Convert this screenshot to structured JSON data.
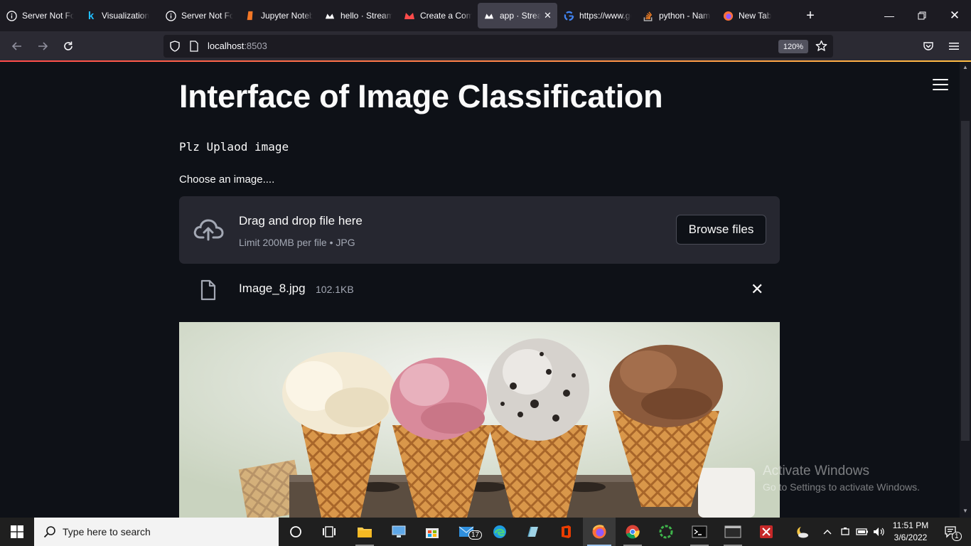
{
  "browser": {
    "tabs": [
      {
        "title": "Server Not Found",
        "icon": "info-icon"
      },
      {
        "title": "Visualization",
        "icon": "kaggle-icon"
      },
      {
        "title": "Server Not Found",
        "icon": "info-icon"
      },
      {
        "title": "Jupyter Notebook",
        "icon": "jupyter-icon"
      },
      {
        "title": "hello · Streamlit",
        "icon": "streamlit-icon"
      },
      {
        "title": "Create a Component",
        "icon": "streamlit-icon"
      },
      {
        "title": "app · Streamlit",
        "icon": "streamlit-icon",
        "active": true
      },
      {
        "title": "https://www.google.com",
        "icon": "google-icon"
      },
      {
        "title": "python - Name",
        "icon": "stackoverflow-icon"
      },
      {
        "title": "New Tab",
        "icon": "firefox-icon"
      }
    ],
    "url_host": "localhost",
    "url_port": ":8503",
    "zoom": "120%"
  },
  "app": {
    "title": "Interface of Image Classification",
    "subtitle": "Plz Uplaod image",
    "uploader_label": "Choose an image....",
    "dropzone_main": "Drag and drop file here",
    "dropzone_sub": "Limit 200MB per file • JPG",
    "browse_label": "Browse files",
    "file_name": "Image_8.jpg",
    "file_size": "102.1KB"
  },
  "watermark": {
    "line1": "Activate Windows",
    "line2": "Go to Settings to activate Windows."
  },
  "taskbar": {
    "search_placeholder": "Type here to search",
    "mail_badge": "17",
    "time": "11:51 PM",
    "date": "3/6/2022",
    "notification_count": "1"
  },
  "colors": {
    "page_bg": "#0e1117",
    "dropzone_bg": "#262730",
    "accent_start": "#ff4b4b",
    "accent_end": "#ffbd45"
  }
}
